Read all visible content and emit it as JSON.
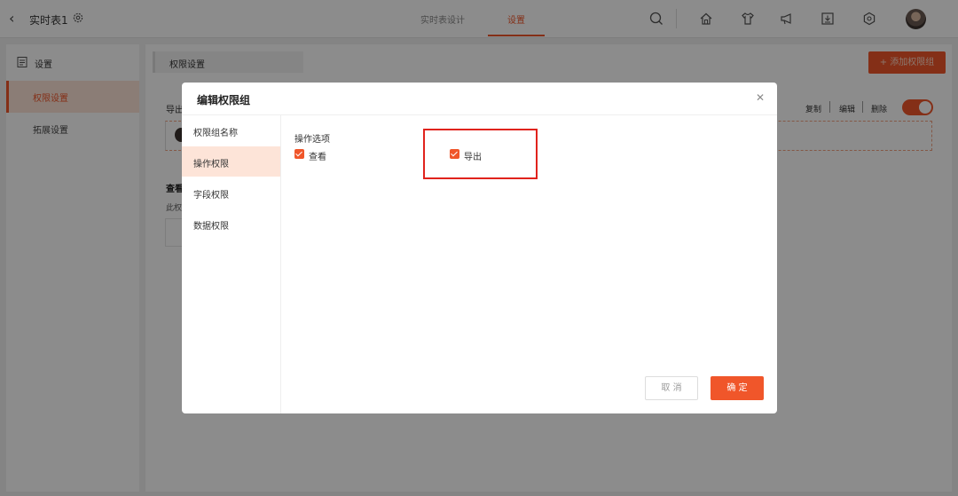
{
  "header": {
    "back_icon": "chevron-left-icon",
    "title": "实时表1",
    "settings_icon": "gear-icon",
    "tabs": [
      {
        "label": "实时表设计",
        "active": false
      },
      {
        "label": "设置",
        "active": true
      }
    ],
    "icons": [
      "search-icon",
      "home-icon",
      "shirt-icon",
      "megaphone-icon",
      "download-icon",
      "hexagon-settings-icon"
    ],
    "accent_color": "#f0562a"
  },
  "sidebar": {
    "header": "设置",
    "items": [
      {
        "label": "权限设置",
        "active": true
      },
      {
        "label": "拓展设置",
        "active": false
      }
    ]
  },
  "main": {
    "breadcrumb": "权限设置",
    "add_group_button": "+ 添加权限组",
    "group_name": "导出",
    "actions": {
      "copy": "复制",
      "edit": "编辑",
      "delete": "删除"
    },
    "toggle_on": true,
    "section_title": "查看",
    "section_desc": "此权"
  },
  "modal": {
    "title": "编辑权限组",
    "close_icon": "close-icon",
    "nav": [
      {
        "label": "权限组名称",
        "active": false
      },
      {
        "label": "操作权限",
        "active": true
      },
      {
        "label": "字段权限",
        "active": false
      },
      {
        "label": "数据权限",
        "active": false
      }
    ],
    "options_title": "操作选项",
    "options": [
      {
        "label": "查看",
        "checked": true
      },
      {
        "label": "导出",
        "checked": true
      }
    ],
    "cancel_button": "取 消",
    "ok_button": "确 定"
  }
}
